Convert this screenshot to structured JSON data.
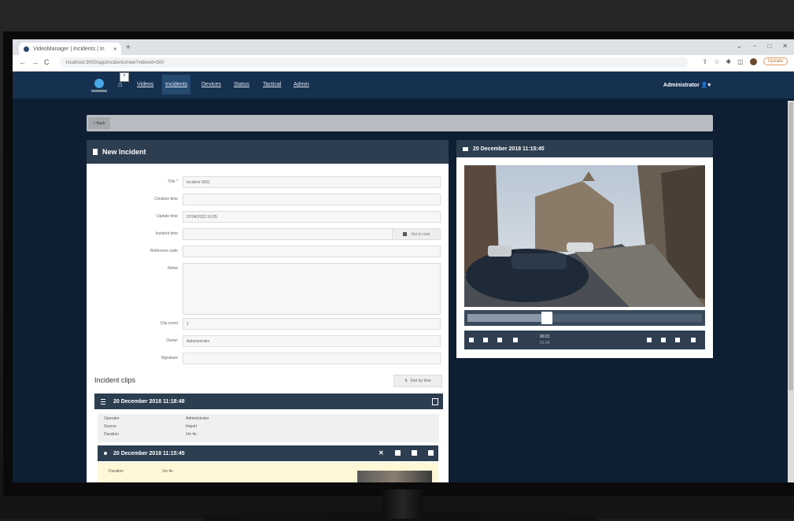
{
  "browser": {
    "tab_title": "VideoManager | Incidents | In",
    "new_tab": "+",
    "url": "localhost:9000/app/incidents/new?videoId=500",
    "nav_back": "←",
    "nav_forward": "→",
    "nav_reload": "C",
    "window_controls": [
      "⌄",
      "−",
      "□",
      "✕"
    ],
    "update_label": "Update"
  },
  "app": {
    "home_glyph": "⌂",
    "nav": [
      "Videos",
      "Incidents",
      "Devices",
      "Status",
      "Tactical",
      "Admin"
    ],
    "user": "Administrator",
    "back_label": "« Back"
  },
  "incident": {
    "header": "New Incident",
    "fields": [
      {
        "label": "Title *",
        "value": "Incident 0001"
      },
      {
        "label": "Creation time",
        "value": ""
      },
      {
        "label": "Update time",
        "value": "07/04/2022 16:35"
      },
      {
        "label": "Incident time",
        "value": ""
      },
      {
        "label": "Reference code",
        "value": ""
      },
      {
        "label": "Notes",
        "value": ""
      },
      {
        "label": "Clip count",
        "value": "1"
      },
      {
        "label": "Owner",
        "value": "Administrator"
      },
      {
        "label": "Signature",
        "value": ""
      }
    ],
    "set_now": "Set to now",
    "clips_heading": "Incident clips",
    "sort_label": "Sort by time",
    "clip_title": "20 December 2018 11:18:48",
    "clip_info": [
      {
        "k": "Operator",
        "v": "Administrator"
      },
      {
        "k": "Source",
        "v": "Import"
      },
      {
        "k": "Duration",
        "v": "1m 4s"
      }
    ],
    "subclip_title": "20 December 2018 11:15:45",
    "subclip_duration_label": "Duration",
    "subclip_duration": "1m 4s"
  },
  "video": {
    "header": "20 December 2018 11:15:45",
    "time_current": "00:21",
    "time_total": "01:04",
    "progress": 0.34
  }
}
